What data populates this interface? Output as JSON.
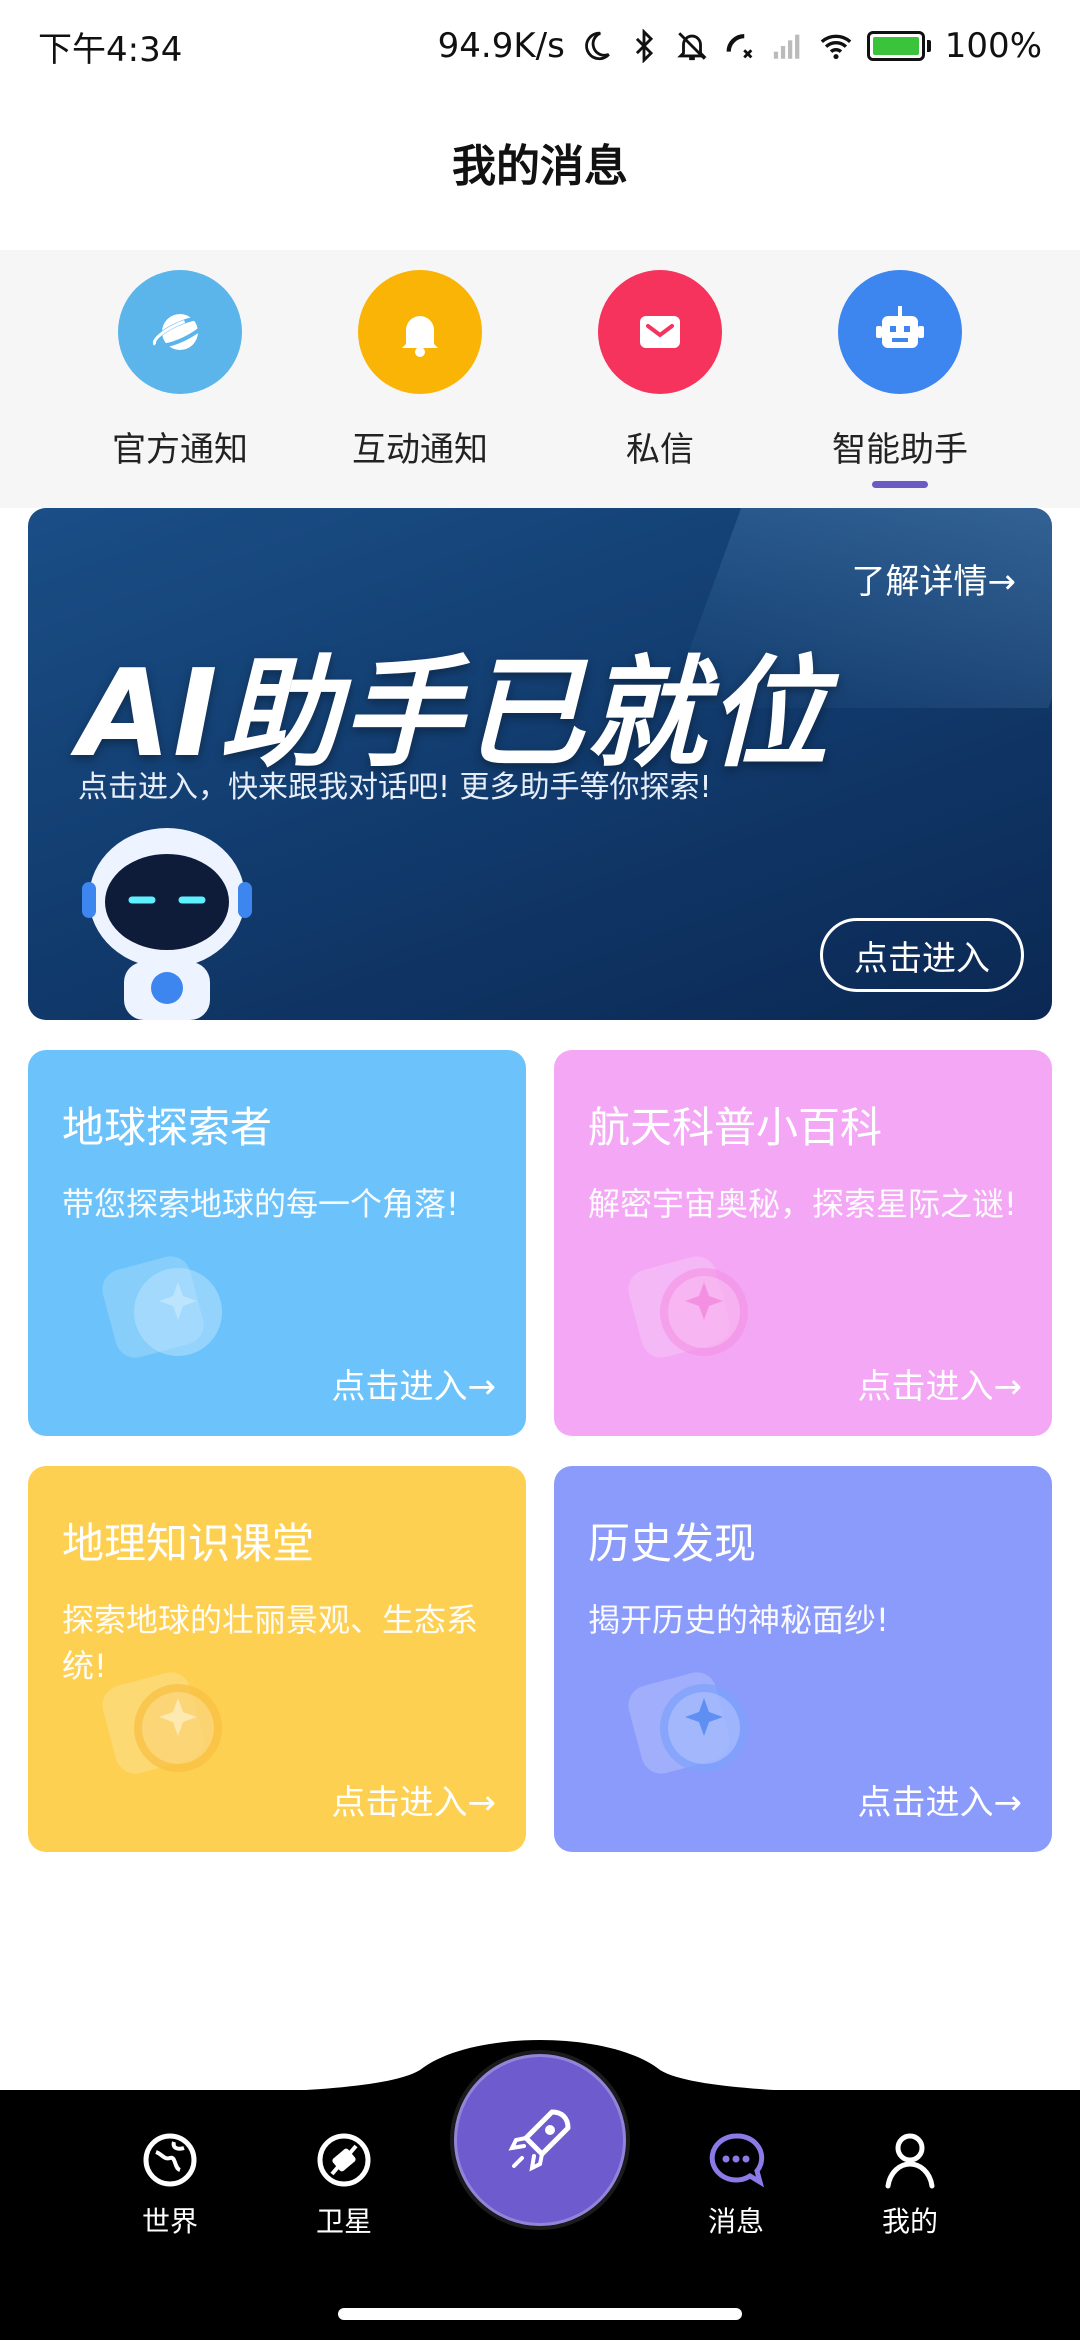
{
  "status_bar": {
    "time": "下午4:34",
    "net_speed": "94.9K/s",
    "battery": "100%"
  },
  "header": {
    "title": "我的消息"
  },
  "categories": [
    {
      "label": "官方通知",
      "icon": "planet-icon",
      "color": "#5bb5ea"
    },
    {
      "label": "互动通知",
      "icon": "bell-icon",
      "color": "#f9b406"
    },
    {
      "label": "私信",
      "icon": "mail-icon",
      "color": "#f5335c"
    },
    {
      "label": "智能助手",
      "icon": "robot-icon",
      "color": "#3d86f0",
      "selected": true
    }
  ],
  "banner": {
    "more_link": "了解详情→",
    "headline": "AI助手已就位",
    "subtitle": "点击进入，快来跟我对话吧! 更多助手等你探索!",
    "cta": "点击进入"
  },
  "cards": [
    {
      "title": "地球探索者",
      "subtitle": "带您探索地球的每一个角落!",
      "cta": "点击进入→",
      "color": "#6cc3fb"
    },
    {
      "title": "航天科普小百科",
      "subtitle": "解密宇宙奥秘，探索星际之谜!",
      "cta": "点击进入→",
      "color": "#f3a7f5"
    },
    {
      "title": "地理知识课堂",
      "subtitle": "探索地球的壮丽景观、生态系统!",
      "cta": "点击进入→",
      "color": "#fdd052"
    },
    {
      "title": "历史发现",
      "subtitle": "揭开历史的神秘面纱!",
      "cta": "点击进入→",
      "color": "#8b9bfb"
    }
  ],
  "bottom_nav": {
    "items": [
      {
        "label": "世界",
        "icon": "globe-icon"
      },
      {
        "label": "卫星",
        "icon": "satellite-icon"
      },
      {
        "label": "消息",
        "icon": "chat-icon",
        "active": true
      },
      {
        "label": "我的",
        "icon": "person-icon"
      }
    ],
    "center_icon": "rocket-icon",
    "accent": "#6e5bcd"
  }
}
